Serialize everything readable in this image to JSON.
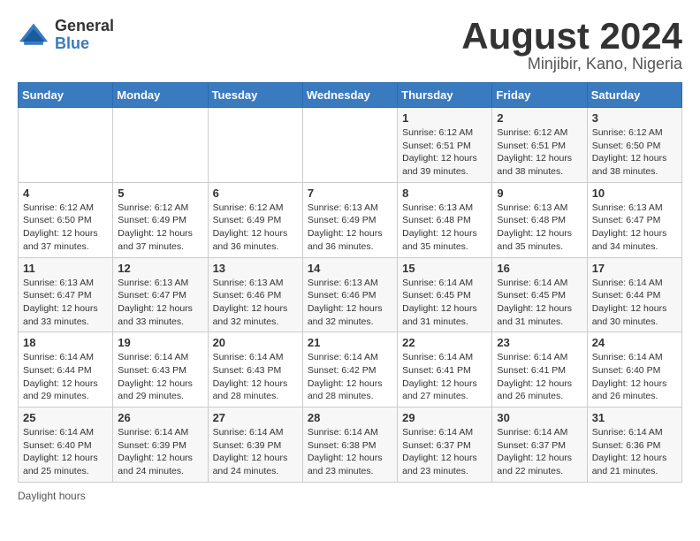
{
  "logo": {
    "general": "General",
    "blue": "Blue"
  },
  "title": "August 2024",
  "location": "Minjibir, Kano, Nigeria",
  "days_header": [
    "Sunday",
    "Monday",
    "Tuesday",
    "Wednesday",
    "Thursday",
    "Friday",
    "Saturday"
  ],
  "weeks": [
    [
      {
        "day": "",
        "info": ""
      },
      {
        "day": "",
        "info": ""
      },
      {
        "day": "",
        "info": ""
      },
      {
        "day": "",
        "info": ""
      },
      {
        "day": "1",
        "info": "Sunrise: 6:12 AM\nSunset: 6:51 PM\nDaylight: 12 hours and 39 minutes."
      },
      {
        "day": "2",
        "info": "Sunrise: 6:12 AM\nSunset: 6:51 PM\nDaylight: 12 hours and 38 minutes."
      },
      {
        "day": "3",
        "info": "Sunrise: 6:12 AM\nSunset: 6:50 PM\nDaylight: 12 hours and 38 minutes."
      }
    ],
    [
      {
        "day": "4",
        "info": "Sunrise: 6:12 AM\nSunset: 6:50 PM\nDaylight: 12 hours and 37 minutes."
      },
      {
        "day": "5",
        "info": "Sunrise: 6:12 AM\nSunset: 6:49 PM\nDaylight: 12 hours and 37 minutes."
      },
      {
        "day": "6",
        "info": "Sunrise: 6:12 AM\nSunset: 6:49 PM\nDaylight: 12 hours and 36 minutes."
      },
      {
        "day": "7",
        "info": "Sunrise: 6:13 AM\nSunset: 6:49 PM\nDaylight: 12 hours and 36 minutes."
      },
      {
        "day": "8",
        "info": "Sunrise: 6:13 AM\nSunset: 6:48 PM\nDaylight: 12 hours and 35 minutes."
      },
      {
        "day": "9",
        "info": "Sunrise: 6:13 AM\nSunset: 6:48 PM\nDaylight: 12 hours and 35 minutes."
      },
      {
        "day": "10",
        "info": "Sunrise: 6:13 AM\nSunset: 6:47 PM\nDaylight: 12 hours and 34 minutes."
      }
    ],
    [
      {
        "day": "11",
        "info": "Sunrise: 6:13 AM\nSunset: 6:47 PM\nDaylight: 12 hours and 33 minutes."
      },
      {
        "day": "12",
        "info": "Sunrise: 6:13 AM\nSunset: 6:47 PM\nDaylight: 12 hours and 33 minutes."
      },
      {
        "day": "13",
        "info": "Sunrise: 6:13 AM\nSunset: 6:46 PM\nDaylight: 12 hours and 32 minutes."
      },
      {
        "day": "14",
        "info": "Sunrise: 6:13 AM\nSunset: 6:46 PM\nDaylight: 12 hours and 32 minutes."
      },
      {
        "day": "15",
        "info": "Sunrise: 6:14 AM\nSunset: 6:45 PM\nDaylight: 12 hours and 31 minutes."
      },
      {
        "day": "16",
        "info": "Sunrise: 6:14 AM\nSunset: 6:45 PM\nDaylight: 12 hours and 31 minutes."
      },
      {
        "day": "17",
        "info": "Sunrise: 6:14 AM\nSunset: 6:44 PM\nDaylight: 12 hours and 30 minutes."
      }
    ],
    [
      {
        "day": "18",
        "info": "Sunrise: 6:14 AM\nSunset: 6:44 PM\nDaylight: 12 hours and 29 minutes."
      },
      {
        "day": "19",
        "info": "Sunrise: 6:14 AM\nSunset: 6:43 PM\nDaylight: 12 hours and 29 minutes."
      },
      {
        "day": "20",
        "info": "Sunrise: 6:14 AM\nSunset: 6:43 PM\nDaylight: 12 hours and 28 minutes."
      },
      {
        "day": "21",
        "info": "Sunrise: 6:14 AM\nSunset: 6:42 PM\nDaylight: 12 hours and 28 minutes."
      },
      {
        "day": "22",
        "info": "Sunrise: 6:14 AM\nSunset: 6:41 PM\nDaylight: 12 hours and 27 minutes."
      },
      {
        "day": "23",
        "info": "Sunrise: 6:14 AM\nSunset: 6:41 PM\nDaylight: 12 hours and 26 minutes."
      },
      {
        "day": "24",
        "info": "Sunrise: 6:14 AM\nSunset: 6:40 PM\nDaylight: 12 hours and 26 minutes."
      }
    ],
    [
      {
        "day": "25",
        "info": "Sunrise: 6:14 AM\nSunset: 6:40 PM\nDaylight: 12 hours and 25 minutes."
      },
      {
        "day": "26",
        "info": "Sunrise: 6:14 AM\nSunset: 6:39 PM\nDaylight: 12 hours and 24 minutes."
      },
      {
        "day": "27",
        "info": "Sunrise: 6:14 AM\nSunset: 6:39 PM\nDaylight: 12 hours and 24 minutes."
      },
      {
        "day": "28",
        "info": "Sunrise: 6:14 AM\nSunset: 6:38 PM\nDaylight: 12 hours and 23 minutes."
      },
      {
        "day": "29",
        "info": "Sunrise: 6:14 AM\nSunset: 6:37 PM\nDaylight: 12 hours and 23 minutes."
      },
      {
        "day": "30",
        "info": "Sunrise: 6:14 AM\nSunset: 6:37 PM\nDaylight: 12 hours and 22 minutes."
      },
      {
        "day": "31",
        "info": "Sunrise: 6:14 AM\nSunset: 6:36 PM\nDaylight: 12 hours and 21 minutes."
      }
    ]
  ],
  "footer": "Daylight hours"
}
